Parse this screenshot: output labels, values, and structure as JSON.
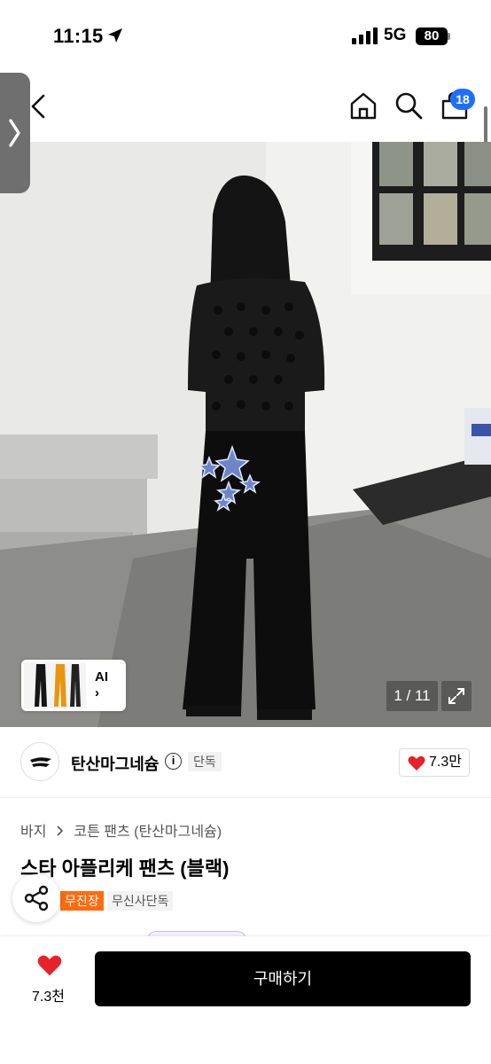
{
  "status": {
    "time": "11:15",
    "network": "5G",
    "battery": "80"
  },
  "header": {
    "cart_count": "18"
  },
  "gallery": {
    "ai_label": "AI",
    "ai_arrow": "›",
    "counter": "1 / 11"
  },
  "brand": {
    "name": "탄산마그네슘",
    "info": "i",
    "exclusive_tag": "단독",
    "likes": "7.3만"
  },
  "product": {
    "breadcrumb": [
      "바지",
      "코튼 팬츠 (탄산마그네슘)"
    ],
    "title": "스타 아플리케 팬츠 (블랙)",
    "tags": [
      "무진장",
      "무신사단독"
    ]
  },
  "bottom": {
    "like_count": "7.3천",
    "buy_label": "구매하기"
  },
  "colors": {
    "accent_badge": "#1f6fff",
    "tag_orange": "#ff6b0f",
    "heart": "#e8202a"
  },
  "icons": [
    "location-arrow-icon",
    "back-chevron-icon",
    "home-icon",
    "search-icon",
    "cart-icon",
    "expand-icon",
    "share-icon",
    "heart-icon",
    "info-icon"
  ]
}
